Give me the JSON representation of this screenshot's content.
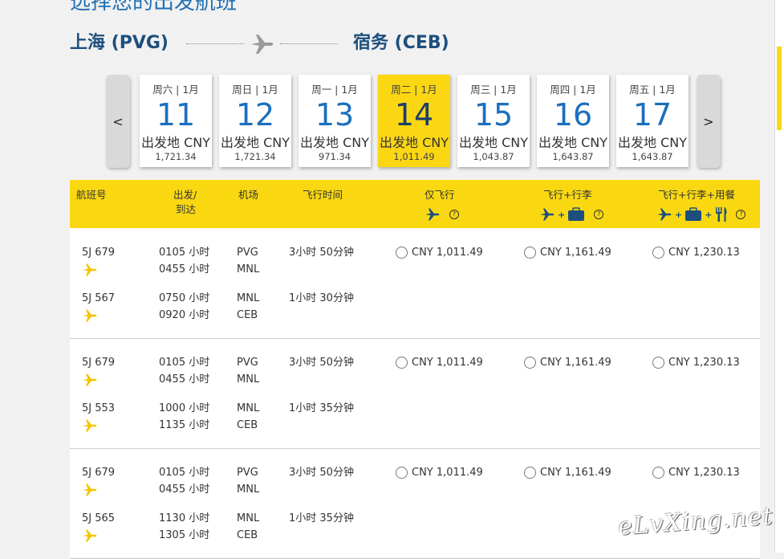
{
  "page": {
    "heading": "选择您的出发航班"
  },
  "route": {
    "origin": "上海 (PVG)",
    "destination": "宿务 (CEB)"
  },
  "date_nav": {
    "prev": "<",
    "next": ">"
  },
  "dates": [
    {
      "dow": "周六 | 1月",
      "day": "11",
      "label": "出发地 CNY",
      "price": "1,721.34",
      "selected": false
    },
    {
      "dow": "周日 | 1月",
      "day": "12",
      "label": "出发地 CNY",
      "price": "1,721.34",
      "selected": false
    },
    {
      "dow": "周一 | 1月",
      "day": "13",
      "label": "出发地 CNY",
      "price": "971.34",
      "selected": false
    },
    {
      "dow": "周二 | 1月",
      "day": "14",
      "label": "出发地 CNY",
      "price": "1,011.49",
      "selected": true
    },
    {
      "dow": "周三 | 1月",
      "day": "15",
      "label": "出发地 CNY",
      "price": "1,043.87",
      "selected": false
    },
    {
      "dow": "周四 | 1月",
      "day": "16",
      "label": "出发地 CNY",
      "price": "1,643.87",
      "selected": false
    },
    {
      "dow": "周五 | 1月",
      "day": "17",
      "label": "出发地 CNY",
      "price": "1,643.87",
      "selected": false
    }
  ],
  "table": {
    "headers": {
      "flight_no": "航班号",
      "dep_arr_1": "出发/",
      "dep_arr_2": "到达",
      "airport": "机场",
      "duration": "飞行时间",
      "fare_fly": "仅飞行",
      "fare_bag": "飞行+行李",
      "fare_meal": "飞行+行李+用餐",
      "help": "?"
    },
    "groups": [
      {
        "legs": [
          {
            "flight": "5J 679",
            "dep": "0105 小时",
            "arr": "0455 小时",
            "from": "PVG",
            "to": "MNL",
            "duration": "3小时 50分钟"
          },
          {
            "flight": "5J 567",
            "dep": "0750 小时",
            "arr": "0920 小时",
            "from": "MNL",
            "to": "CEB",
            "duration": "1小时 30分钟"
          }
        ],
        "fares": [
          "CNY 1,011.49",
          "CNY 1,161.49",
          "CNY 1,230.13"
        ]
      },
      {
        "legs": [
          {
            "flight": "5J 679",
            "dep": "0105 小时",
            "arr": "0455 小时",
            "from": "PVG",
            "to": "MNL",
            "duration": "3小时 50分钟"
          },
          {
            "flight": "5J 553",
            "dep": "1000 小时",
            "arr": "1135 小时",
            "from": "MNL",
            "to": "CEB",
            "duration": "1小时 35分钟"
          }
        ],
        "fares": [
          "CNY 1,011.49",
          "CNY 1,161.49",
          "CNY 1,230.13"
        ]
      },
      {
        "legs": [
          {
            "flight": "5J 679",
            "dep": "0105 小时",
            "arr": "0455 小时",
            "from": "PVG",
            "to": "MNL",
            "duration": "3小时 50分钟"
          },
          {
            "flight": "5J 565",
            "dep": "1130 小时",
            "arr": "1305 小时",
            "from": "MNL",
            "to": "CEB",
            "duration": "1小时 35分钟"
          }
        ],
        "fares": [
          "CNY 1,011.49",
          "CNY 1,161.49",
          "CNY 1,230.13"
        ]
      }
    ]
  },
  "watermark": "eLvXing.net",
  "colors": {
    "brand_yellow": "#f9d811",
    "heading_blue": "#1f6fb3",
    "route_blue": "#1d4f7e",
    "plane_yellow": "#f5c400"
  }
}
